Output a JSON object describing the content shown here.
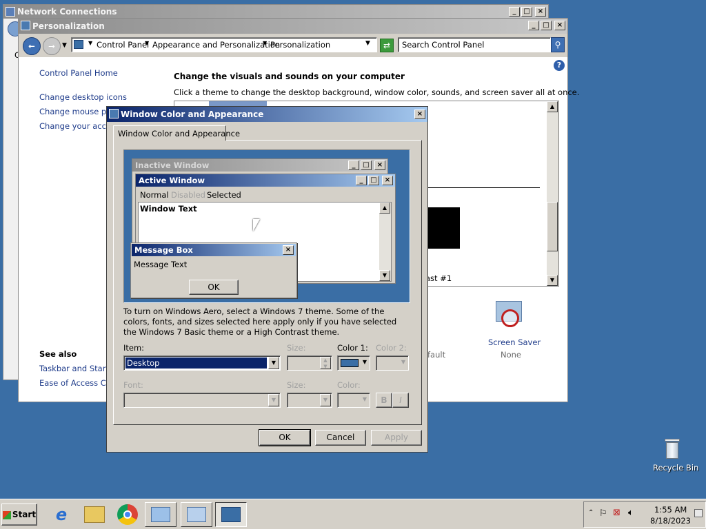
{
  "network_window": {
    "title": "Network Connections",
    "partial_label": "C"
  },
  "personalization": {
    "title": "Personalization",
    "breadcrumb": [
      "Control Panel",
      "Appearance and Personalization",
      "Personalization"
    ],
    "search_placeholder": "Search Control Panel",
    "sidebar": {
      "home": "Control Panel Home",
      "links": [
        "Change desktop icons",
        "Change mouse pointers",
        "Change your account picture"
      ],
      "see_also_heading": "See also",
      "see_also": [
        "Taskbar and Start Menu",
        "Ease of Access Center"
      ]
    },
    "heading": "Change the visuals and sounds on your computer",
    "subheading": "Click a theme to change the desktop background, window color, sounds, and screen saver all at once.",
    "theme_label_partial": "ast #1",
    "bottom": {
      "default_partial": "fault",
      "screen_saver_label": "Screen Saver",
      "screen_saver_value": "None"
    }
  },
  "dialog": {
    "title": "Window Color and Appearance",
    "tab": "Window Color and Appearance",
    "preview": {
      "inactive_title": "Inactive Window",
      "active_title": "Active Window",
      "menu": [
        "Normal",
        "Disabled",
        "Selected"
      ],
      "window_text": "Window Text",
      "msgbox_title": "Message Box",
      "msgbox_text": "Message Text",
      "msgbox_ok": "OK"
    },
    "info": "To turn on Windows Aero, select a Windows 7 theme.  Some of the colors, fonts, and sizes selected here apply only if you have selected the Windows 7 Basic theme or a High Contrast theme.",
    "item_label": "Item:",
    "item_value": "Desktop",
    "size_label": "Size:",
    "color1_label": "Color 1:",
    "color2_label": "Color 2:",
    "font_label": "Font:",
    "font_size_label": "Size:",
    "font_color_label": "Color:",
    "bold": "B",
    "italic": "I",
    "ok": "OK",
    "cancel": "Cancel",
    "apply": "Apply",
    "color1_value": "#3a6ea5"
  },
  "desktop": {
    "recycle_bin": "Recycle Bin"
  },
  "taskbar": {
    "start": "Start",
    "time": "1:55 AM",
    "date": "8/18/2023"
  }
}
